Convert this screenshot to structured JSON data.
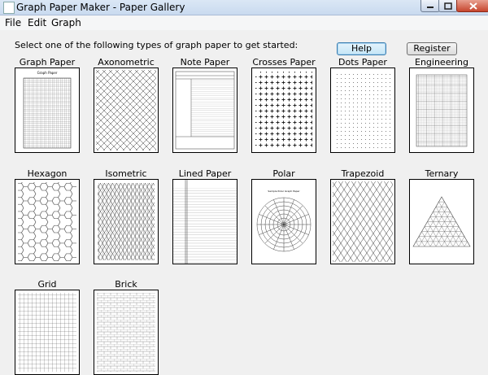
{
  "window": {
    "title": "Graph Paper Maker - Paper Gallery"
  },
  "menu": {
    "items": [
      "File",
      "Edit",
      "Graph"
    ]
  },
  "main": {
    "prompt": "Select one of the following types of graph paper to get started:",
    "help_label": "Help",
    "register_label": "Register"
  },
  "gallery": {
    "items": [
      {
        "label": "Graph Paper",
        "thumb_title": "Graph Paper"
      },
      {
        "label": "Axonometric"
      },
      {
        "label": "Note Paper"
      },
      {
        "label": "Crosses Paper"
      },
      {
        "label": "Dots Paper"
      },
      {
        "label": "Engineering"
      },
      {
        "label": "Hexagon"
      },
      {
        "label": "Isometric"
      },
      {
        "label": "Lined Paper"
      },
      {
        "label": "Polar",
        "thumb_title": "Sample Polar Graph Paper"
      },
      {
        "label": "Trapezoid"
      },
      {
        "label": "Ternary"
      },
      {
        "label": "Grid"
      },
      {
        "label": "Brick"
      }
    ]
  }
}
